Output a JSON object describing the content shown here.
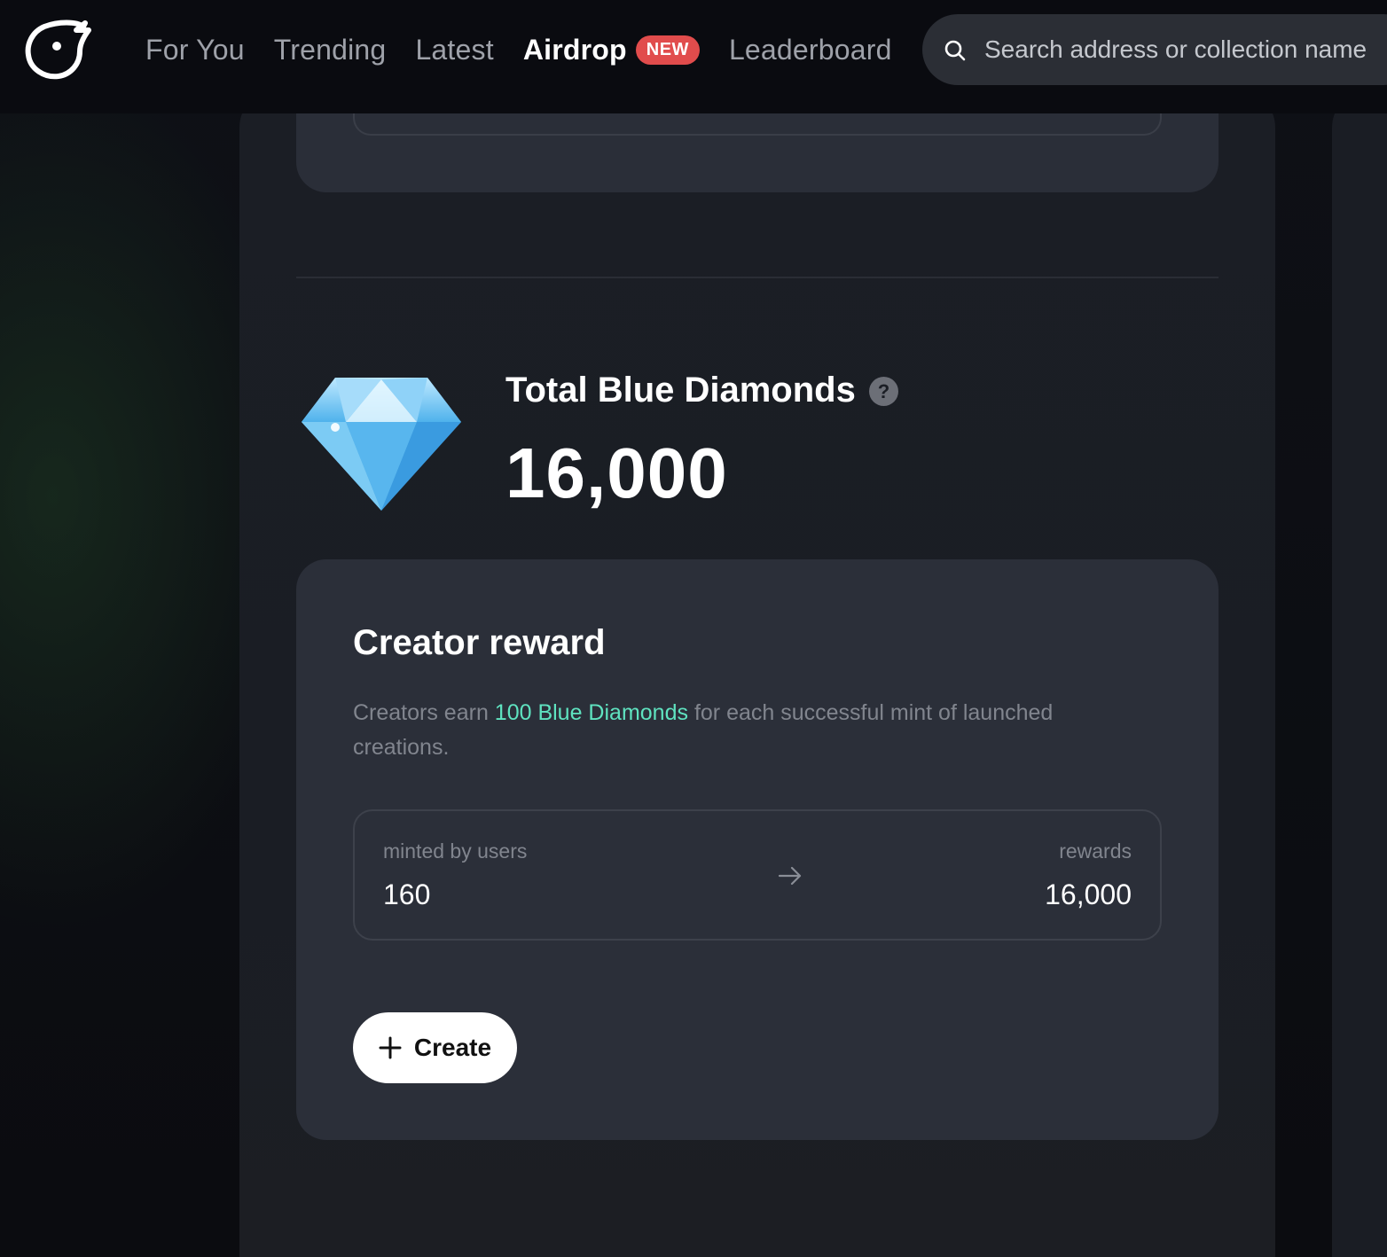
{
  "nav": {
    "items": [
      {
        "label": "For You"
      },
      {
        "label": "Trending"
      },
      {
        "label": "Latest"
      },
      {
        "label": "Airdrop"
      },
      {
        "label": "Leaderboard"
      }
    ],
    "active_index": 3,
    "new_badge": "NEW"
  },
  "search": {
    "placeholder": "Search address or collection name",
    "value": ""
  },
  "total": {
    "label": "Total Blue Diamonds",
    "help_icon": "?",
    "value": "16,000"
  },
  "creator_reward": {
    "title": "Creator reward",
    "desc_before": "Creators earn ",
    "desc_highlight": "100 Blue Diamonds",
    "desc_after": " for each successful mint of launched creations.",
    "minted_label": "minted by users",
    "minted_value": "160",
    "rewards_label": "rewards",
    "rewards_value": "16,000",
    "create_label": "Create"
  },
  "colors": {
    "accent": "#5fe3c0",
    "badge": "#e14c4c",
    "background": "#0b0d12",
    "card": "#2b2f39"
  },
  "icons": {
    "logo": "bird-logo-icon",
    "search": "search-icon",
    "help": "question-icon",
    "diamond": "blue-diamond-icon",
    "arrow": "arrow-right-icon",
    "plus": "plus-icon"
  }
}
